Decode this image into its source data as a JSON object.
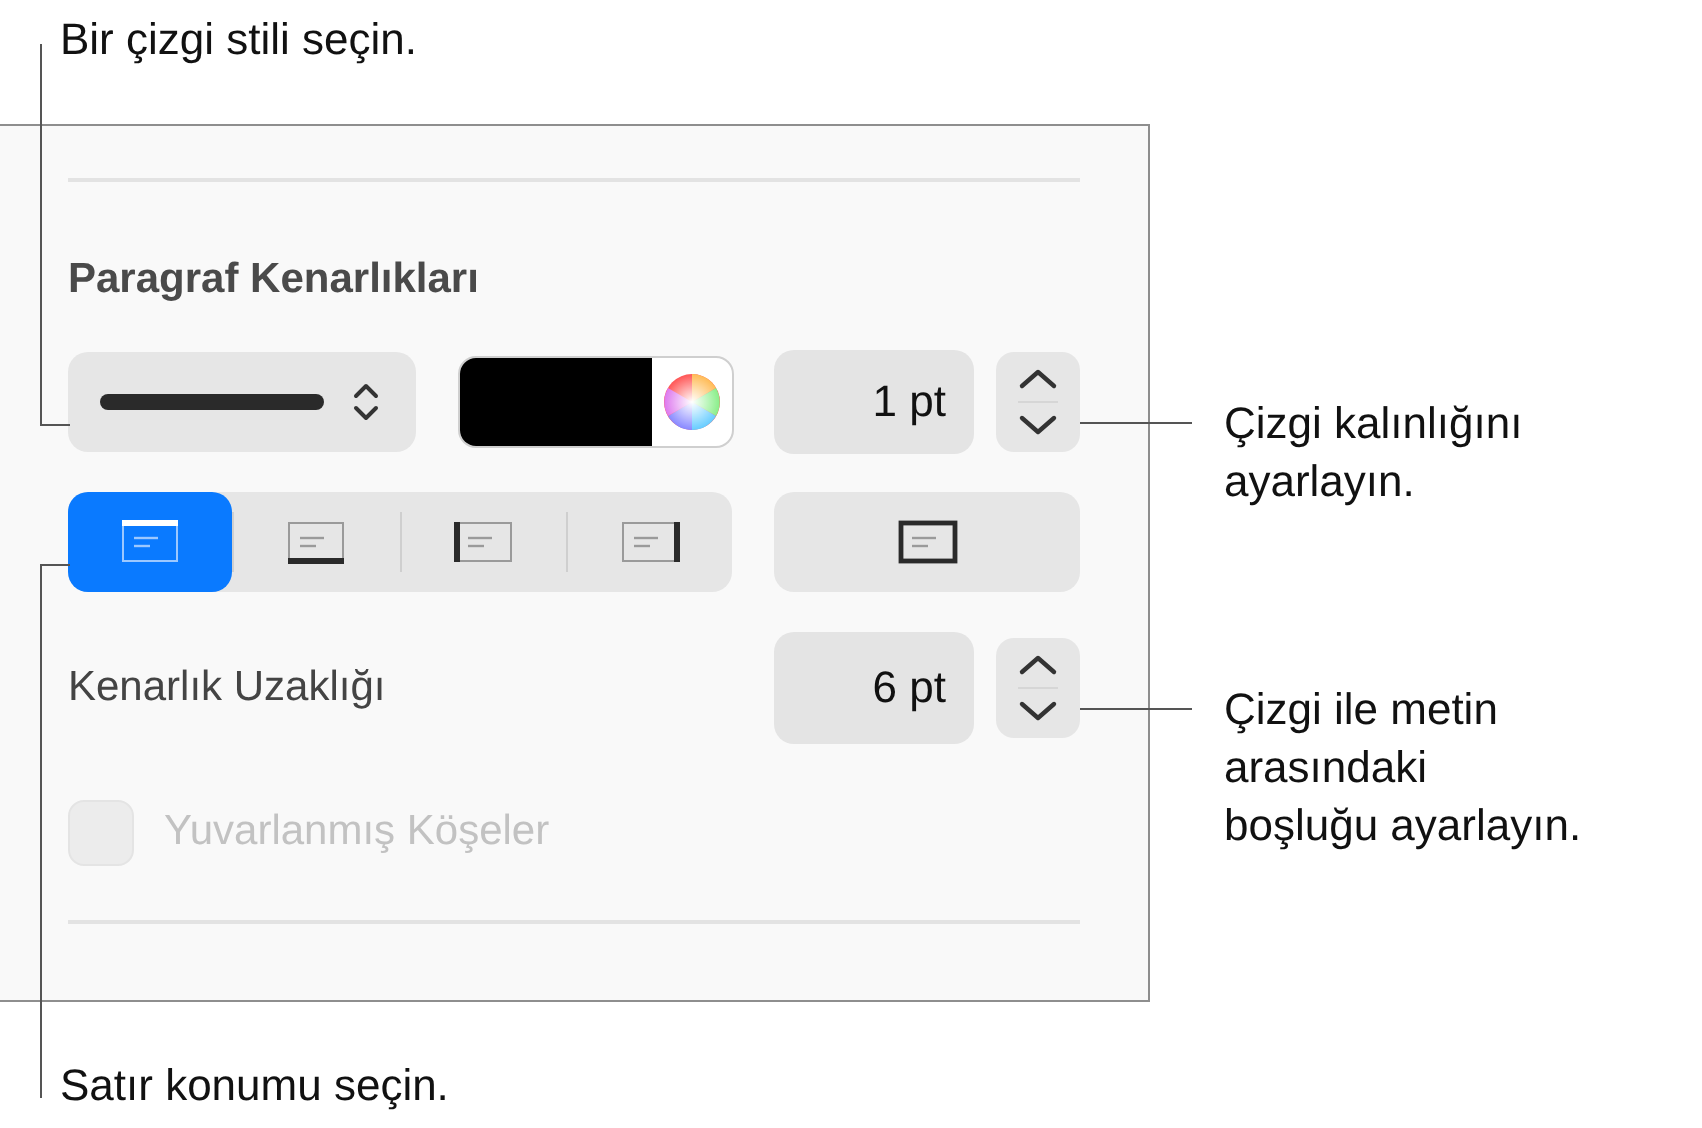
{
  "callouts": {
    "line_style": "Bir çizgi stili seçin.",
    "line_width": "Çizgi kalınlığını\nayarlayın.",
    "distance": "Çizgi ile metin\narasındaki\nboşluğu ayarlayın.",
    "line_position": "Satır konumu seçin."
  },
  "panel": {
    "title": "Paragraf Kenarlıkları",
    "color_well": {
      "color": "#000000"
    },
    "width_field": {
      "value": "1 pt"
    },
    "position_segments": [
      {
        "kind": "top",
        "selected": true
      },
      {
        "kind": "bottom",
        "selected": false
      },
      {
        "kind": "left",
        "selected": false
      },
      {
        "kind": "right",
        "selected": false
      }
    ],
    "box_button": {
      "kind": "box",
      "selected": false
    },
    "distance": {
      "label": "Kenarlık Uzaklığı",
      "value": "6 pt"
    },
    "rounded_corners": {
      "label": "Yuvarlanmış Köşeler",
      "checked": false,
      "disabled": true
    }
  }
}
